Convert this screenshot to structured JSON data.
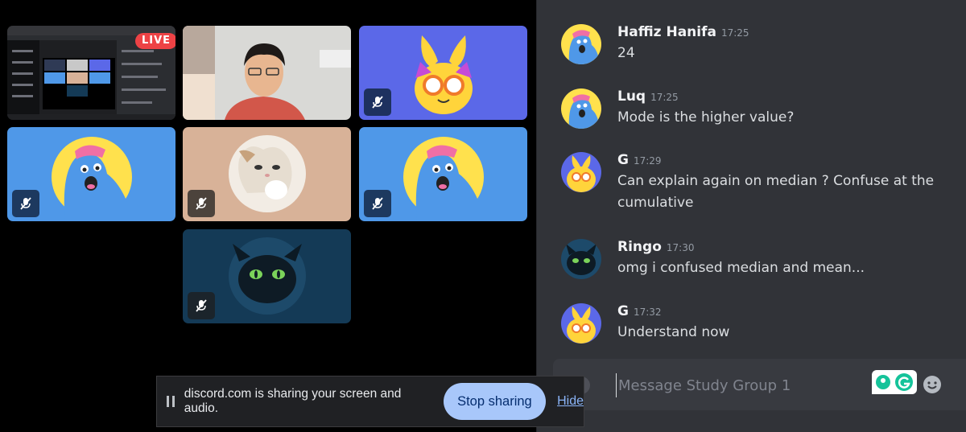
{
  "stream": {
    "live_badge": "LIVE"
  },
  "chat": {
    "messages": [
      {
        "author": "Haffiz Hanifa",
        "time": "17:25",
        "text": "24",
        "avatar": "blue-wumpus-avatar"
      },
      {
        "author": "Luq",
        "time": "17:25",
        "text": "Mode is the higher value?",
        "avatar": "blue-wumpus-avatar"
      },
      {
        "author": "G",
        "time": "17:29",
        "text": "Can explain again on median ? Confuse at the cumulative",
        "avatar": "yellow-rabbit-avatar"
      },
      {
        "author": "Ringo",
        "time": "17:30",
        "text": "omg i confused median and mean...",
        "avatar": "toothless-dragon-avatar"
      },
      {
        "author": "G",
        "time": "17:32",
        "text": "Understand now",
        "avatar": "yellow-rabbit-avatar"
      }
    ],
    "composer": {
      "placeholder": "Message Study Group 1"
    }
  },
  "share_bar": {
    "message": "discord.com is sharing your screen and audio.",
    "stop_label": "Stop sharing",
    "hide_label": "Hide"
  },
  "colors": {
    "tile_blue": "#4f98e8",
    "tile_indigo": "#5b68e8",
    "tile_tan": "#d8b298",
    "tile_navy": "#143a56",
    "live_red": "#ed4245",
    "chat_bg": "#313338",
    "stop_button": "#a8c7fa"
  }
}
